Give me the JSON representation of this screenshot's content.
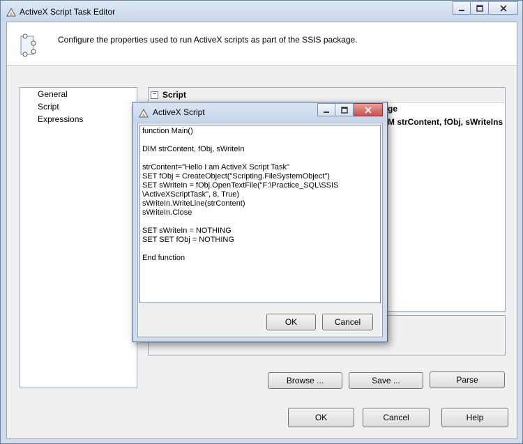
{
  "window": {
    "title": "ActiveX Script Task Editor",
    "caption_buttons": [
      "minimize",
      "maximize",
      "close"
    ]
  },
  "header": {
    "description": "Configure the properties used to run ActiveX scripts as part of the SSIS package."
  },
  "nav": {
    "items": [
      {
        "label": "General"
      },
      {
        "label": "Script"
      },
      {
        "label": "Expressions"
      }
    ]
  },
  "property_grid": {
    "category": "Script",
    "partial_label": "ge",
    "partial_value": "M strContent, fObj, sWriteIns"
  },
  "buttons": {
    "browse": "Browse ...",
    "save": "Save ...",
    "parse": "Parse",
    "ok": "OK",
    "cancel": "Cancel",
    "help": "Help"
  },
  "dialog": {
    "title": "ActiveX Script",
    "script": "function Main()\n\nDIM strContent, fObj, sWriteIn\n\nstrContent=\"Hello I am ActiveX Script Task\"\nSET fObj = CreateObject(\"Scripting.FileSystemObject\")\nSET sWriteIn = fObj.OpenTextFile(\"F:\\Practice_SQL\\SSIS\n\\ActiveXScriptTask\", 8, True)\nsWriteIn.WriteLine(strContent)\nsWriteIn.Close\n\nSET sWriteIn = NOTHING\nSET SET fObj = NOTHING\n\nEnd function",
    "ok": "OK",
    "cancel": "Cancel"
  },
  "colors": {
    "window_frame": "#cfdcec",
    "client_bg": "#f0f0f0",
    "close_button": "#c75050"
  }
}
